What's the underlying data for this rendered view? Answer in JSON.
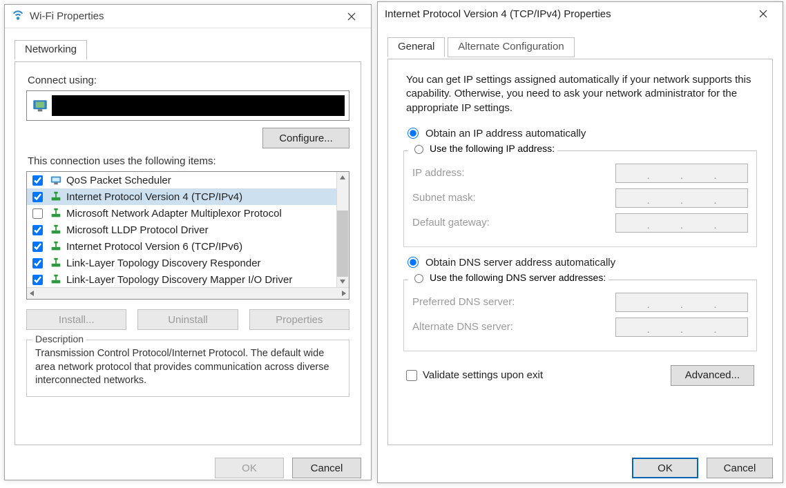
{
  "wifi": {
    "title": "Wi-Fi Properties",
    "tab_networking": "Networking",
    "connect_using_label": "Connect using:",
    "configure_btn": "Configure...",
    "items_label": "This connection uses the following items:",
    "items": [
      {
        "checked": true,
        "icon": "qos-icon",
        "label": "QoS Packet Scheduler",
        "selected": false
      },
      {
        "checked": true,
        "icon": "proto-icon",
        "label": "Internet Protocol Version 4 (TCP/IPv4)",
        "selected": true
      },
      {
        "checked": false,
        "icon": "proto-icon",
        "label": "Microsoft Network Adapter Multiplexor Protocol",
        "selected": false
      },
      {
        "checked": true,
        "icon": "proto-icon",
        "label": "Microsoft LLDP Protocol Driver",
        "selected": false
      },
      {
        "checked": true,
        "icon": "proto-icon",
        "label": "Internet Protocol Version 6 (TCP/IPv6)",
        "selected": false
      },
      {
        "checked": true,
        "icon": "proto-icon",
        "label": "Link-Layer Topology Discovery Responder",
        "selected": false
      },
      {
        "checked": true,
        "icon": "proto-icon",
        "label": "Link-Layer Topology Discovery Mapper I/O Driver",
        "selected": false
      }
    ],
    "install_btn": "Install...",
    "uninstall_btn": "Uninstall",
    "properties_btn": "Properties",
    "description_legend": "Description",
    "description_text": "Transmission Control Protocol/Internet Protocol. The default wide area network protocol that provides communication across diverse interconnected networks.",
    "ok_btn": "OK",
    "cancel_btn": "Cancel"
  },
  "ipv4": {
    "title": "Internet Protocol Version 4 (TCP/IPv4) Properties",
    "tab_general": "General",
    "tab_alt": "Alternate Configuration",
    "info": "You can get IP settings assigned automatically if your network supports this capability. Otherwise, you need to ask your network administrator for the appropriate IP settings.",
    "radio_obtain_ip": "Obtain an IP address automatically",
    "radio_use_ip": "Use the following IP address:",
    "lbl_ip": "IP address:",
    "lbl_subnet": "Subnet mask:",
    "lbl_gateway": "Default gateway:",
    "radio_obtain_dns": "Obtain DNS server address automatically",
    "radio_use_dns": "Use the following DNS server addresses:",
    "lbl_pref_dns": "Preferred DNS server:",
    "lbl_alt_dns": "Alternate DNS server:",
    "validate_cbx": "Validate settings upon exit",
    "advanced_btn": "Advanced...",
    "ok_btn": "OK",
    "cancel_btn": "Cancel",
    "ip_group_selected": "auto",
    "dns_group_selected": "auto",
    "validate_checked": false
  }
}
